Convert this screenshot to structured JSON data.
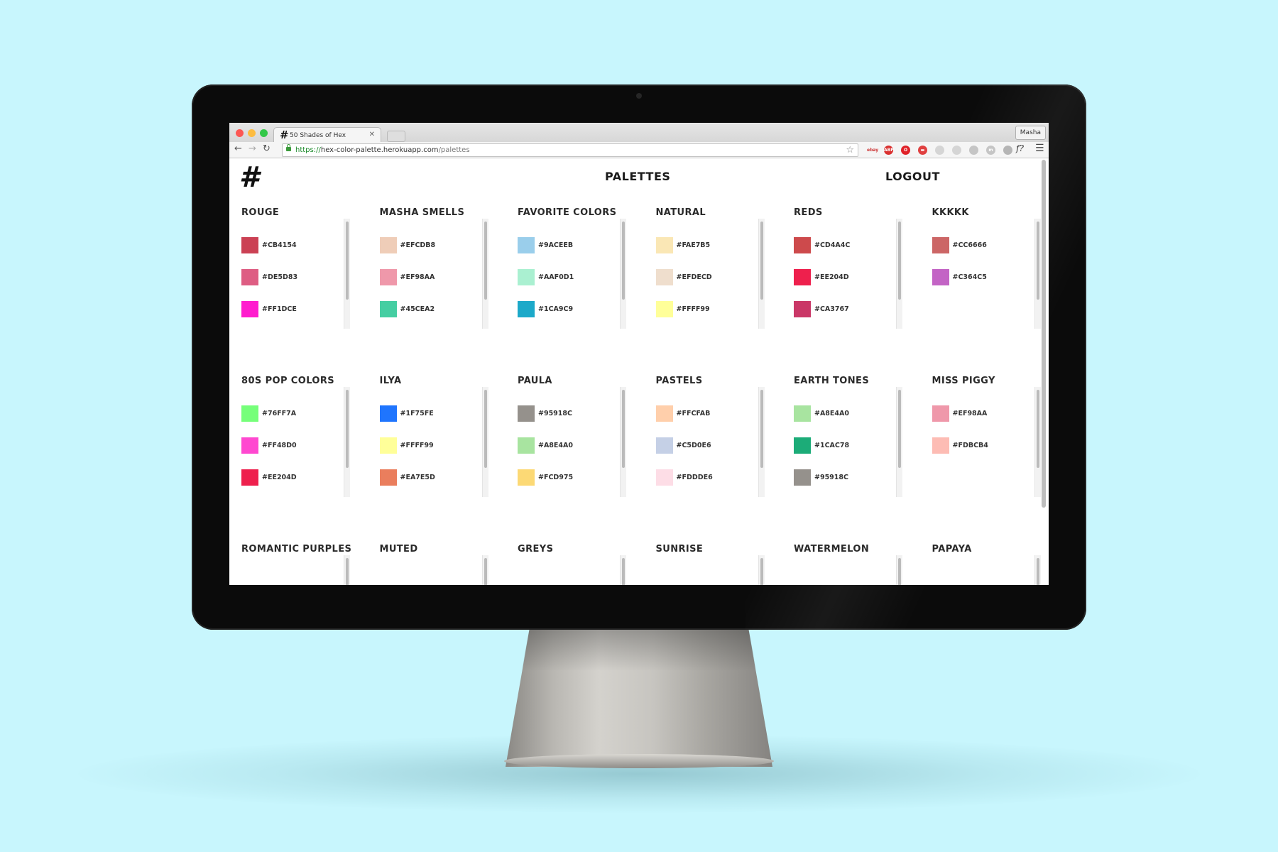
{
  "browser": {
    "tab_title": "50 Shades of Hex",
    "profile_name": "Masha",
    "url_scheme": "https://",
    "url_host": "hex-color-palette.herokuapp.com",
    "url_path": "/palettes",
    "extensions": [
      {
        "icon": "ebay-icon",
        "text": "ebay",
        "color": "#e9e9e9"
      },
      {
        "icon": "adblock-icon",
        "text": "ABP",
        "color": "#d9302f"
      },
      {
        "icon": "opera-icon",
        "text": "O",
        "color": "#e0232a"
      },
      {
        "icon": "pocket-icon",
        "text": "▬",
        "color": "#e04040"
      },
      {
        "icon": "extension-circle-icon",
        "text": "",
        "color": "#d5d5d5"
      },
      {
        "icon": "extension-triangle-icon",
        "text": "",
        "color": "#d5d5d5"
      },
      {
        "icon": "extension-angular-icon",
        "text": "",
        "color": "#c5c5c5"
      },
      {
        "icon": "extension-m-icon",
        "text": "m",
        "color": "#c5c5c5"
      },
      {
        "icon": "extension-check-icon",
        "text": "",
        "color": "#b5b5b5"
      }
    ],
    "font_ext_label": "f?"
  },
  "header": {
    "logo": "#",
    "nav_palettes": "PALETTES",
    "nav_logout": "LOGOUT"
  },
  "palettes": [
    {
      "name": "ROUGE",
      "colors": [
        "#CB4154",
        "#DE5D83",
        "#FF1DCE"
      ]
    },
    {
      "name": "MASHA SMELLS",
      "colors": [
        "#EFCDB8",
        "#EF98AA",
        "#45CEA2"
      ]
    },
    {
      "name": "FAVORITE COLORS",
      "colors": [
        "#9ACEEB",
        "#AAF0D1",
        "#1CA9C9"
      ]
    },
    {
      "name": "NATURAL",
      "colors": [
        "#FAE7B5",
        "#EFDECD",
        "#FFFF99"
      ]
    },
    {
      "name": "REDS",
      "colors": [
        "#CD4A4C",
        "#EE204D",
        "#CA3767"
      ]
    },
    {
      "name": "KKKKK",
      "colors": [
        "#CC6666",
        "#C364C5"
      ]
    },
    {
      "name": "80S POP COLORS",
      "colors": [
        "#76FF7A",
        "#FF48D0",
        "#EE204D"
      ]
    },
    {
      "name": "ILYA",
      "colors": [
        "#1F75FE",
        "#FFFF99",
        "#EA7E5D"
      ]
    },
    {
      "name": "PAULA",
      "colors": [
        "#95918C",
        "#A8E4A0",
        "#FCD975"
      ]
    },
    {
      "name": "PASTELS",
      "colors": [
        "#FFCFAB",
        "#C5D0E6",
        "#FDDDE6"
      ]
    },
    {
      "name": "EARTH TONES",
      "colors": [
        "#A8E4A0",
        "#1CAC78",
        "#95918C"
      ]
    },
    {
      "name": "MISS PIGGY",
      "colors": [
        "#EF98AA",
        "#FDBCB4"
      ]
    },
    {
      "name": "ROMANTIC PURPLES",
      "colors": []
    },
    {
      "name": "MUTED",
      "colors": []
    },
    {
      "name": "GREYS",
      "colors": []
    },
    {
      "name": "SUNRISE",
      "colors": []
    },
    {
      "name": "WATERMELON",
      "colors": []
    },
    {
      "name": "PAPAYA",
      "colors": []
    }
  ]
}
